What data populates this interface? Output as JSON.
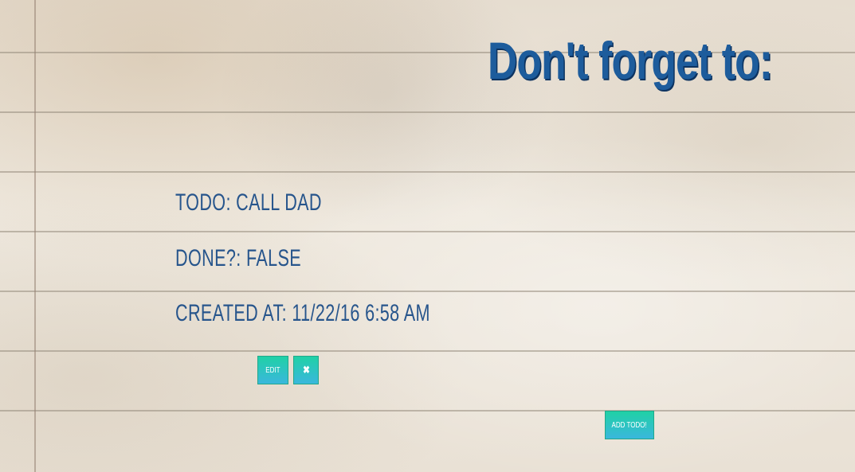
{
  "header": {
    "title": "Don't forget to:"
  },
  "todo": {
    "todo_label": "todo:",
    "todo_value": "call dad",
    "done_label": "done?:",
    "done_value": "false",
    "created_label": "created at:",
    "created_value": "11/22/16 6:58 AM"
  },
  "actions": {
    "edit_label": "edit",
    "delete_label": "✖",
    "add_label": "add todo!"
  },
  "colors": {
    "title": "#1d5c9c",
    "text": "#27558c",
    "button_top": "#20d1a6",
    "button_bottom": "#3ab7dc"
  }
}
